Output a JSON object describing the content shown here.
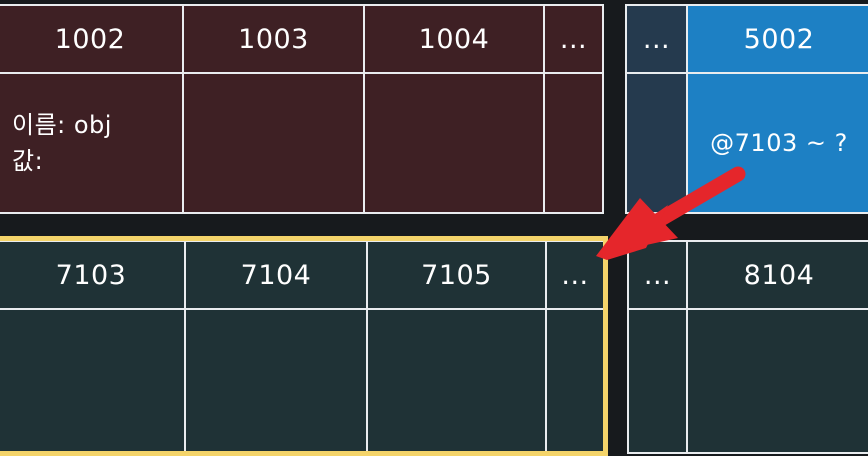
{
  "top_heap": {
    "headers": [
      "1002",
      "1003",
      "1004",
      "..."
    ],
    "name_label": "이름: obj",
    "value_label": "값:"
  },
  "top_right": {
    "ellipsis": "...",
    "header": "5002",
    "value": "@7103 ~ ?"
  },
  "bottom_heap": {
    "headers": [
      "7103",
      "7104",
      "7105",
      "..."
    ]
  },
  "bottom_right": {
    "ellipsis": "...",
    "header": "8104"
  },
  "colors": {
    "top_cells": "#3e2024",
    "bottom_cells": "#1f3236",
    "highlight_cell": "#1d80c4",
    "highlight_frame": "#f4d46a",
    "arrow": "#e5262b"
  }
}
